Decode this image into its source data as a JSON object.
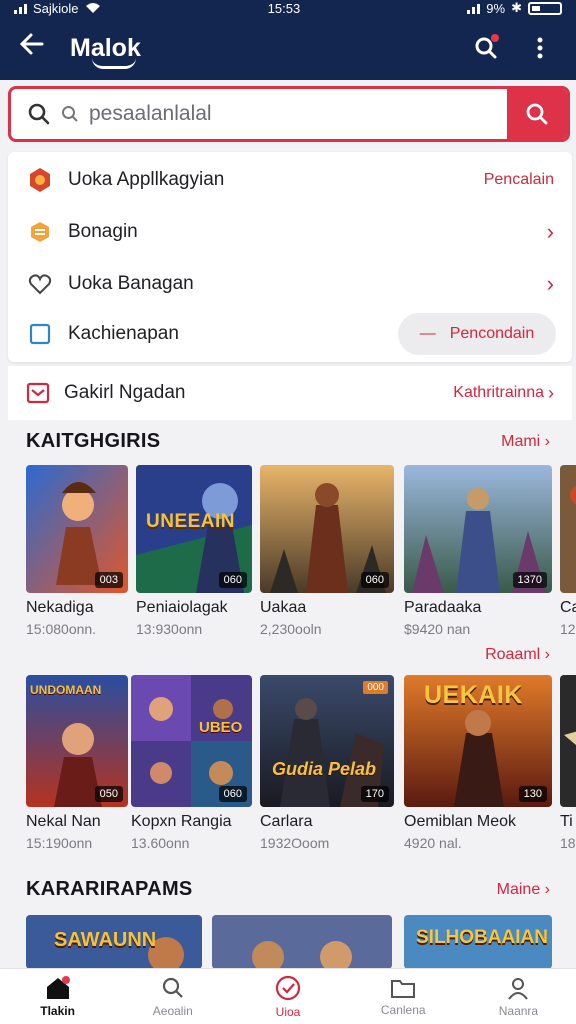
{
  "status": {
    "carrier": "Sajkiole",
    "time": "15:53",
    "battery": "9%"
  },
  "appbar": {
    "title": "Malok",
    "back_icon": "arrow-left-icon",
    "search_icon": "search-settings-icon",
    "more_icon": "more-vertical-icon"
  },
  "search": {
    "placeholder": "pesaalanlalal",
    "button_icon": "search-icon"
  },
  "menu": [
    {
      "label": "Uoka Appllkagyian",
      "right": "Pencalain",
      "icon": "badge-icon"
    },
    {
      "label": "Bonagin",
      "icon": "cube-icon"
    },
    {
      "label": "Uoka Banagan",
      "icon": "heart-icon"
    },
    {
      "label": "Kachienapan",
      "right": "Pencondain",
      "icon": "square-icon"
    }
  ],
  "gift_row": {
    "label": "Gakirl Ngadan",
    "right": "Kathritrainna",
    "icon": "gift-icon"
  },
  "sections": [
    {
      "title": "KAITGHGIRIS",
      "more": "Mami"
    },
    {
      "more": "Roaaml"
    },
    {
      "title": "KARARIRAPAMS",
      "more": "Maine"
    }
  ],
  "row1": [
    {
      "title": "Nekadiga",
      "meta": "15:080onn.",
      "badge": "003"
    },
    {
      "title": "Peniaiolagak",
      "meta": "13:930onn",
      "badge": "060",
      "art_title": "UNEEAIN"
    },
    {
      "title": "Uakaa",
      "meta": "2,230ooln",
      "badge": "060"
    },
    {
      "title": "Paradaaka",
      "meta": "$9420 nan",
      "badge": "1370"
    },
    {
      "title": "Ca",
      "meta": "12"
    }
  ],
  "row2": [
    {
      "title": "Nekal Nan",
      "meta": "15:190onn",
      "badge": "050",
      "art_title": "UNDOMAAN"
    },
    {
      "title": "Kopxn Rangia",
      "meta": "13.60onn",
      "badge": "060",
      "art_title": "UBEO"
    },
    {
      "title": "Carlara",
      "meta": "1932Ooom",
      "badge": "170",
      "tag": "000",
      "art_title": "Gudia Pelab"
    },
    {
      "title": "Oemiblan Meok",
      "meta": "4920 nal.",
      "badge": "130",
      "art_title": "UEKAIK"
    },
    {
      "title": "Ti",
      "meta": "18"
    }
  ],
  "row3": [
    {
      "art_title": "SAWAUNN"
    },
    {
      "art_title": ""
    },
    {
      "art_title": "SILHOBAAIAN"
    }
  ],
  "bottom_nav": [
    {
      "label": "Tlakin",
      "icon": "home-icon"
    },
    {
      "label": "Aeoalin",
      "icon": "search-icon"
    },
    {
      "label": "Uioa",
      "icon": "heart-badge-icon"
    },
    {
      "label": "Canlena",
      "icon": "folder-icon"
    },
    {
      "label": "Naanra",
      "icon": "profile-icon"
    }
  ],
  "colors": {
    "header": "#12264f",
    "accent": "#de3248",
    "background": "#f2f2f4"
  }
}
